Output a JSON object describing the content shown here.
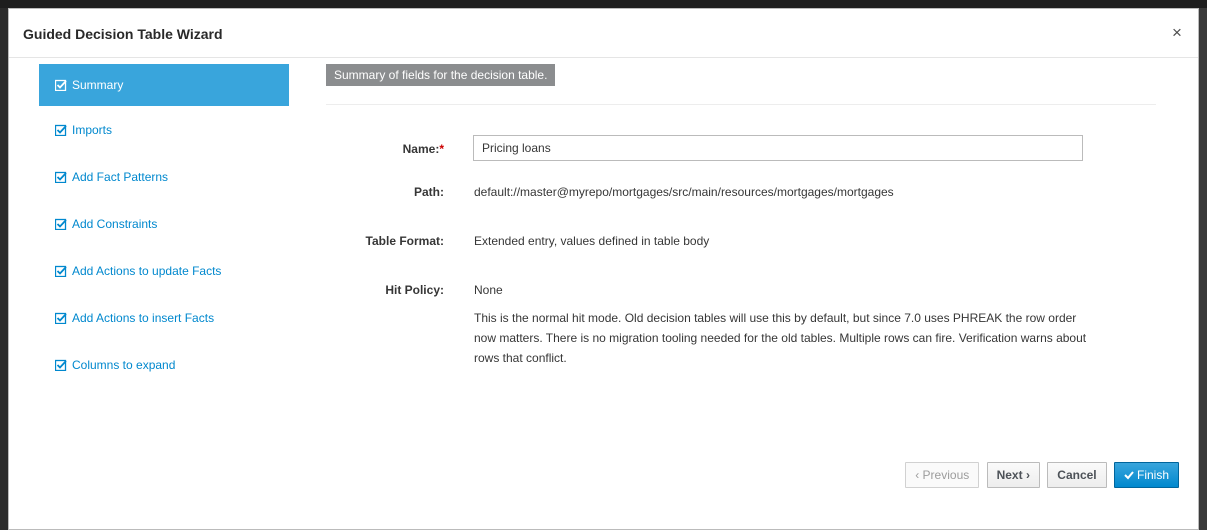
{
  "dialog": {
    "title": "Guided Decision Table Wizard",
    "close_glyph": "×"
  },
  "sidebar": {
    "items": [
      {
        "label": "Summary",
        "active": true
      },
      {
        "label": "Imports"
      },
      {
        "label": "Add Fact Patterns"
      },
      {
        "label": "Add Constraints"
      },
      {
        "label": "Add Actions to update Facts"
      },
      {
        "label": "Add Actions to insert Facts"
      },
      {
        "label": "Columns to expand"
      }
    ]
  },
  "summary": {
    "banner": "Summary of fields for the decision table.",
    "name_label": "Name:",
    "required_mark": "*",
    "name_value": "Pricing loans",
    "path_label": "Path:",
    "path_value": "default://master@myrepo/mortgages/src/main/resources/mortgages/mortgages",
    "format_label": "Table Format:",
    "format_value": "Extended entry, values defined in table body",
    "hit_policy_label": "Hit Policy:",
    "hit_policy_value": "None",
    "hit_policy_desc": "This is the normal hit mode. Old decision tables will use this by default, but since 7.0 uses PHREAK the row order now matters. There is no migration tooling needed for the old tables. Multiple rows can fire. Verification warns about rows that conflict."
  },
  "footer": {
    "previous": "‹ Previous",
    "next": "Next ›",
    "cancel": "Cancel",
    "finish": "Finish"
  },
  "colors": {
    "accent": "#39a5dc",
    "link": "#0088ce",
    "banner": "#8b8d8f",
    "required": "#cc0000"
  }
}
